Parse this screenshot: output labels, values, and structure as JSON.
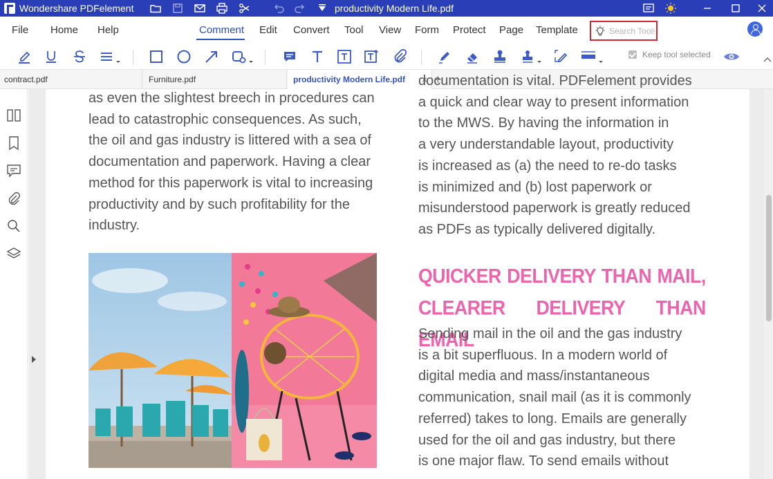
{
  "titlebar": {
    "app_name": "Wondershare PDFelement",
    "doc_title": "productivity Modern Life.pdf",
    "icons": [
      "folder-icon",
      "save-icon",
      "mail-icon",
      "print-icon",
      "scissors-icon",
      "undo-icon",
      "redo-icon",
      "dropdown-icon",
      "message-icon",
      "sun-icon",
      "minimize-icon",
      "maximize-icon",
      "close-icon"
    ]
  },
  "menu": {
    "items": [
      "File",
      "Home",
      "Help",
      "Comment",
      "Edit",
      "Convert",
      "Tool",
      "View",
      "Form",
      "Protect",
      "Page",
      "Template"
    ],
    "active": "Comment",
    "search_placeholder": "Search Tools"
  },
  "toolbar": {
    "keep_tool_label": "Keep tool selected",
    "keep_tool_checked": true,
    "tools": [
      "highlight",
      "underline",
      "strikethrough",
      "text-lines",
      "rectangle",
      "ellipse",
      "arrow",
      "shape",
      "sticky-note",
      "typewriter",
      "text-box",
      "text-callout",
      "attachment",
      "pencil",
      "eraser",
      "stamp",
      "signature",
      "area-highlight",
      "measure",
      "show-hide-annotations"
    ]
  },
  "tabs": {
    "items": [
      {
        "label": "contract.pdf"
      },
      {
        "label": "Furniture.pdf"
      },
      {
        "label": "productivity Modern Life.pdf"
      }
    ],
    "active": "productivity Modern Life.pdf",
    "close_label": "×",
    "add_label": "+"
  },
  "sidebar": {
    "icons": [
      "thumbnail-icon",
      "bookmark-icon",
      "comment-icon",
      "attachment-icon",
      "search-icon",
      "layers-icon"
    ]
  },
  "document": {
    "left_lines": [
      "as even the slightest breech in procedures can",
      "lead to catastrophic consequences. As such,",
      "the oil and gas industry is littered with a sea of",
      "documentation and paperwork. Having a clear",
      "method for this paperwork is vital to increasing",
      "productivity and by such profitability for the",
      "industry."
    ],
    "right_lines_1": [
      "documentation is vital. PDFelement provides",
      "a quick and clear way to present information",
      "to the MWS. By having the information in",
      "a very understandable layout, productivity",
      "is increased as (a) the need to re-do tasks",
      "is minimized and (b) lost paperwork or",
      "misunderstood paperwork is greatly reduced",
      "as PDFs as typically delivered digitally."
    ],
    "heading_lines": [
      "QUICKER DELIVERY THAN MAIL,",
      "CLEARER DELIVERY THAN EMAIL"
    ],
    "right_lines_2": [
      "Sending mail in the oil and the gas industry",
      "is a bit superfluous. In a modern world of",
      "digital media and mass/instantaneous",
      "communication, snail mail (as it is commonly",
      "referred) takes to long. Emails are generally",
      "used for the oil and gas industry, but there",
      "is one major flaw. To send emails without"
    ],
    "colors": {
      "accent": "#2a3fb7",
      "heading": "#ec64ad",
      "body_text": "#555555"
    }
  }
}
